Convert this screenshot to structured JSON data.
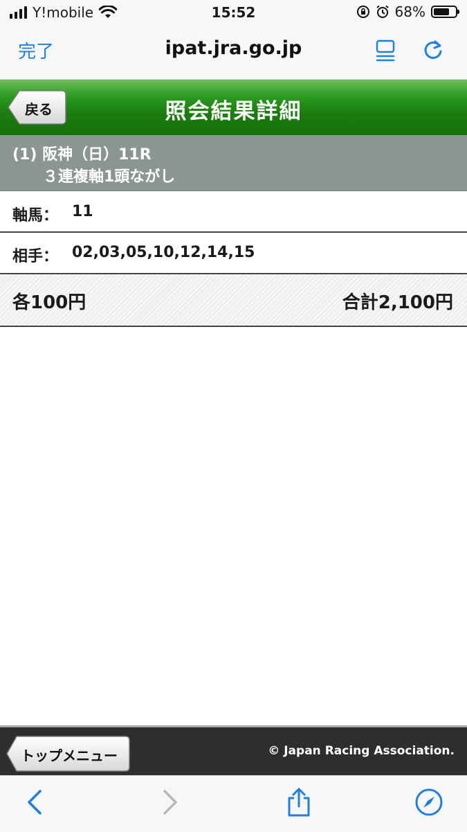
{
  "status_bar": {
    "carrier": "Y!mobile",
    "time": "15:52",
    "battery_percent": "68%",
    "battery_level": 0.68
  },
  "browser": {
    "done_label": "完了",
    "url": "ipat.jra.go.jp"
  },
  "header": {
    "back_label": "戻る",
    "title": "照会結果詳細"
  },
  "race": {
    "line1": "(1) 阪神（日）11R",
    "line2": "３連複軸1頭ながし"
  },
  "details": {
    "axis_label": "軸馬：",
    "axis_value": "11",
    "partner_label": "相手：",
    "partner_value": "02,03,05,10,12,14,15"
  },
  "amount": {
    "each": "各100円",
    "total": "合計2,100円"
  },
  "footer": {
    "top_menu_label": "トップメニュー",
    "copyright": "© Japan Racing Association."
  },
  "colors": {
    "accent_blue": "#1e7fe0",
    "header_green": "#1b7d0f",
    "race_band_gray": "#8c9690",
    "footer_dark": "#2e2e2e"
  }
}
